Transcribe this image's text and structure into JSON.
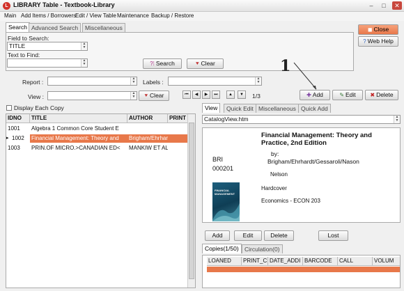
{
  "window": {
    "title": "LIBRARY Table - Textbook-Library",
    "min": "–",
    "max": "□",
    "close": "✕",
    "app_icon": "L"
  },
  "menu": [
    "Main",
    "Add Items / Borrowers",
    "Edit / View Table",
    "Maintenance",
    "Backup / Restore"
  ],
  "search_tabs": [
    "Search",
    "Advanced Search",
    "Miscellaneous"
  ],
  "search": {
    "field_label": "Field to Search:",
    "field_value": "TITLE",
    "find_label": "Text to Find:",
    "find_value": "",
    "search_button": "Search",
    "clear_button": "Clear"
  },
  "right_buttons": {
    "close": "Close",
    "web_help": "Web Help"
  },
  "annotation": "1",
  "filters": {
    "report_label": "Report :",
    "labels_label": "Labels :",
    "view_label": "View :",
    "clear_button": "Clear",
    "record_pos": "1/3"
  },
  "nav": {
    "first": "⏮",
    "prev": "◀",
    "next": "▶",
    "last": "⏭",
    "up": "▲",
    "down": "▼"
  },
  "actions": {
    "add": "Add",
    "edit": "Edit",
    "delete": "Delete"
  },
  "display_each_copy": "Display Each Copy",
  "table": {
    "columns": [
      "IDNO",
      "TITLE",
      "AUTHOR",
      "PRINT"
    ],
    "rows": [
      [
        "1001",
        "Algebra 1 Common Core Student E",
        "",
        ""
      ],
      [
        "1002",
        "Financial Management: Theory and",
        "Brigham/Ehrhardt",
        ""
      ],
      [
        "1003",
        "PRIN.OF MICRO.>CANADIAN ED<",
        "MANKIW ET AL",
        ""
      ]
    ],
    "selected_index": 1
  },
  "view_tabs": [
    "View",
    "Quick Edit",
    "Miscellaneous",
    "Quick Add"
  ],
  "catalog_file": "CatalogView.htm",
  "preview": {
    "call_1": "BRI",
    "call_2": "000201",
    "title": "Financial Management: Theory and Practice, 2nd Edition",
    "by": "by:",
    "authors": "Brigham/Ehrhardt/Gessaroli/Nason",
    "publisher": "Nelson",
    "format": "Hardcover",
    "subject": "Economics - ECON 203",
    "cover_text": "FINANCIAL MANAGEMENT"
  },
  "copy_buttons": {
    "add": "Add",
    "edit": "Edit",
    "delete": "Delete",
    "lost": "Lost"
  },
  "copy_tabs": [
    "Copies(1/50)",
    "Circulation(0)"
  ],
  "copies": {
    "columns": [
      "LOANED",
      "PRINT_C",
      "DATE_ADDI",
      "BARCODE",
      "CALL",
      "VOLUM"
    ]
  },
  "colors": {
    "accent": "#e8784a",
    "close_btn": "#e8784a"
  }
}
